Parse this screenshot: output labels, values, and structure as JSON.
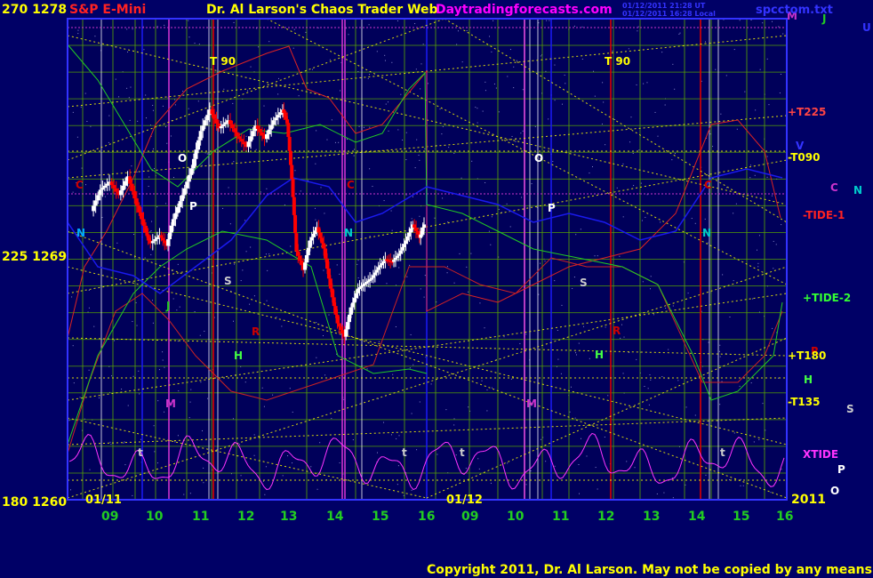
{
  "header": {
    "price_label": "270  1278",
    "symbol": "S&P E-Mini",
    "title": "Dr. Al Larson's Chaos Trader Web",
    "site": "Daytradingforecasts.com",
    "stamp_line1": "01/12/2011 21:28 UT",
    "stamp_line2": "01/12/2011 16:28 Local",
    "file": "spcctom.txt"
  },
  "footer": {
    "copyright": "Copyright 2011, Dr. Al Larson. May not be copied by any means."
  },
  "colors": {
    "background": "#000066",
    "plot_bg": "#00005a",
    "frame": "#3333ff",
    "grid_green": "#5aa800",
    "yellow": "#ffff00",
    "red": "#dd0000",
    "green": "#22cc22",
    "blue": "#1a1aee",
    "magenta": "#cc33cc",
    "white": "#ffffff"
  },
  "chart_data": {
    "type": "line",
    "title": "S&P E-Mini",
    "y_axis": {
      "labels": [
        "270  1278",
        "225  1269",
        "180  1260"
      ],
      "price_range": [
        1260,
        1278
      ],
      "angle_range": [
        180,
        270
      ]
    },
    "x_axis": {
      "hour_ticks": [
        "09",
        "10",
        "11",
        "12",
        "13",
        "14",
        "15",
        "16",
        "09",
        "10",
        "11",
        "12",
        "13",
        "14",
        "15",
        "16"
      ],
      "date_labels": [
        "01/11",
        "01/12"
      ],
      "year_label": "2011"
    },
    "price_bars": {
      "description": "S&P E-Mini price bars, 01/11 session",
      "close_path": [
        [
          8.7,
          1270.8
        ],
        [
          8.9,
          1271.6
        ],
        [
          9.1,
          1271.9
        ],
        [
          9.3,
          1271.4
        ],
        [
          9.5,
          1272.1
        ],
        [
          9.7,
          1271.0
        ],
        [
          9.9,
          1270.0
        ],
        [
          10.0,
          1269.6
        ],
        [
          10.2,
          1269.9
        ],
        [
          10.35,
          1269.5
        ],
        [
          10.5,
          1270.5
        ],
        [
          10.7,
          1271.4
        ],
        [
          10.9,
          1272.4
        ],
        [
          11.1,
          1273.8
        ],
        [
          11.3,
          1274.6
        ],
        [
          11.5,
          1273.9
        ],
        [
          11.7,
          1274.2
        ],
        [
          11.9,
          1273.6
        ],
        [
          12.1,
          1273.2
        ],
        [
          12.3,
          1274.0
        ],
        [
          12.5,
          1273.5
        ],
        [
          12.7,
          1274.2
        ],
        [
          12.9,
          1274.6
        ],
        [
          13.0,
          1274.1
        ],
        [
          13.1,
          1272.0
        ],
        [
          13.2,
          1269.3
        ],
        [
          13.35,
          1268.6
        ],
        [
          13.5,
          1269.7
        ],
        [
          13.65,
          1270.2
        ],
        [
          13.8,
          1269.4
        ],
        [
          13.95,
          1267.9
        ],
        [
          14.1,
          1266.6
        ],
        [
          14.25,
          1266.1
        ],
        [
          14.4,
          1267.2
        ],
        [
          14.55,
          1267.9
        ],
        [
          14.7,
          1268.1
        ],
        [
          14.85,
          1268.3
        ],
        [
          15.0,
          1268.7
        ],
        [
          15.15,
          1269.0
        ],
        [
          15.3,
          1268.9
        ],
        [
          15.45,
          1269.2
        ],
        [
          15.6,
          1269.7
        ],
        [
          15.75,
          1270.3
        ],
        [
          15.9,
          1269.8
        ],
        [
          16.0,
          1270.3
        ]
      ]
    },
    "series": [
      {
        "name": "+T225",
        "color": "#ff4444"
      },
      {
        "name": "-T090",
        "color": "#ffff00"
      },
      {
        "name": "-TIDE-1",
        "color": "#ff2222"
      },
      {
        "name": "+TIDE-2",
        "color": "#33ff33"
      },
      {
        "name": "+T180",
        "color": "#ffff00"
      },
      {
        "name": "-T135",
        "color": "#ffff00"
      },
      {
        "name": "XTIDE",
        "color": "#ff33ff"
      }
    ],
    "planet_labels": [
      {
        "text": "T  90",
        "color": "#ffff00"
      },
      {
        "text": "T  90",
        "color": "#ffff00"
      },
      {
        "text": "O",
        "color": "#ffffff"
      },
      {
        "text": "O",
        "color": "#ffffff"
      },
      {
        "text": "C",
        "color": "#cc0000"
      },
      {
        "text": "C",
        "color": "#cc0000"
      },
      {
        "text": "C",
        "color": "#cc0000"
      },
      {
        "text": "C",
        "color": "#cc33cc"
      },
      {
        "text": "N",
        "color": "#00aaff"
      },
      {
        "text": "N",
        "color": "#00cccc"
      },
      {
        "text": "N",
        "color": "#00cccc"
      },
      {
        "text": "N",
        "color": "#00cccc"
      },
      {
        "text": "P",
        "color": "#ffffff"
      },
      {
        "text": "P",
        "color": "#ffffff"
      },
      {
        "text": "P",
        "color": "#ffffff"
      },
      {
        "text": "S",
        "color": "#cccccc"
      },
      {
        "text": "S",
        "color": "#cccccc"
      },
      {
        "text": "S",
        "color": "#cccccc"
      },
      {
        "text": "J",
        "color": "#22cc22"
      },
      {
        "text": "J",
        "color": "#22cc22"
      },
      {
        "text": "R",
        "color": "#cc0000"
      },
      {
        "text": "R",
        "color": "#cc0000"
      },
      {
        "text": "R",
        "color": "#cc0000"
      },
      {
        "text": "H",
        "color": "#44ff44"
      },
      {
        "text": "H",
        "color": "#44ff44"
      },
      {
        "text": "H",
        "color": "#44ff44"
      },
      {
        "text": "M",
        "color": "#cc33cc"
      },
      {
        "text": "M",
        "color": "#cc33cc"
      },
      {
        "text": "M",
        "color": "#cc33cc"
      },
      {
        "text": "V",
        "color": "#3333ff"
      },
      {
        "text": "U",
        "color": "#3333ff"
      },
      {
        "text": "O",
        "color": "#ffffff"
      },
      {
        "text": "t",
        "color": "#cccccc"
      },
      {
        "text": "t",
        "color": "#cccccc"
      },
      {
        "text": "t",
        "color": "#cccccc"
      },
      {
        "text": "t",
        "color": "#cccccc"
      }
    ],
    "grid": true
  }
}
